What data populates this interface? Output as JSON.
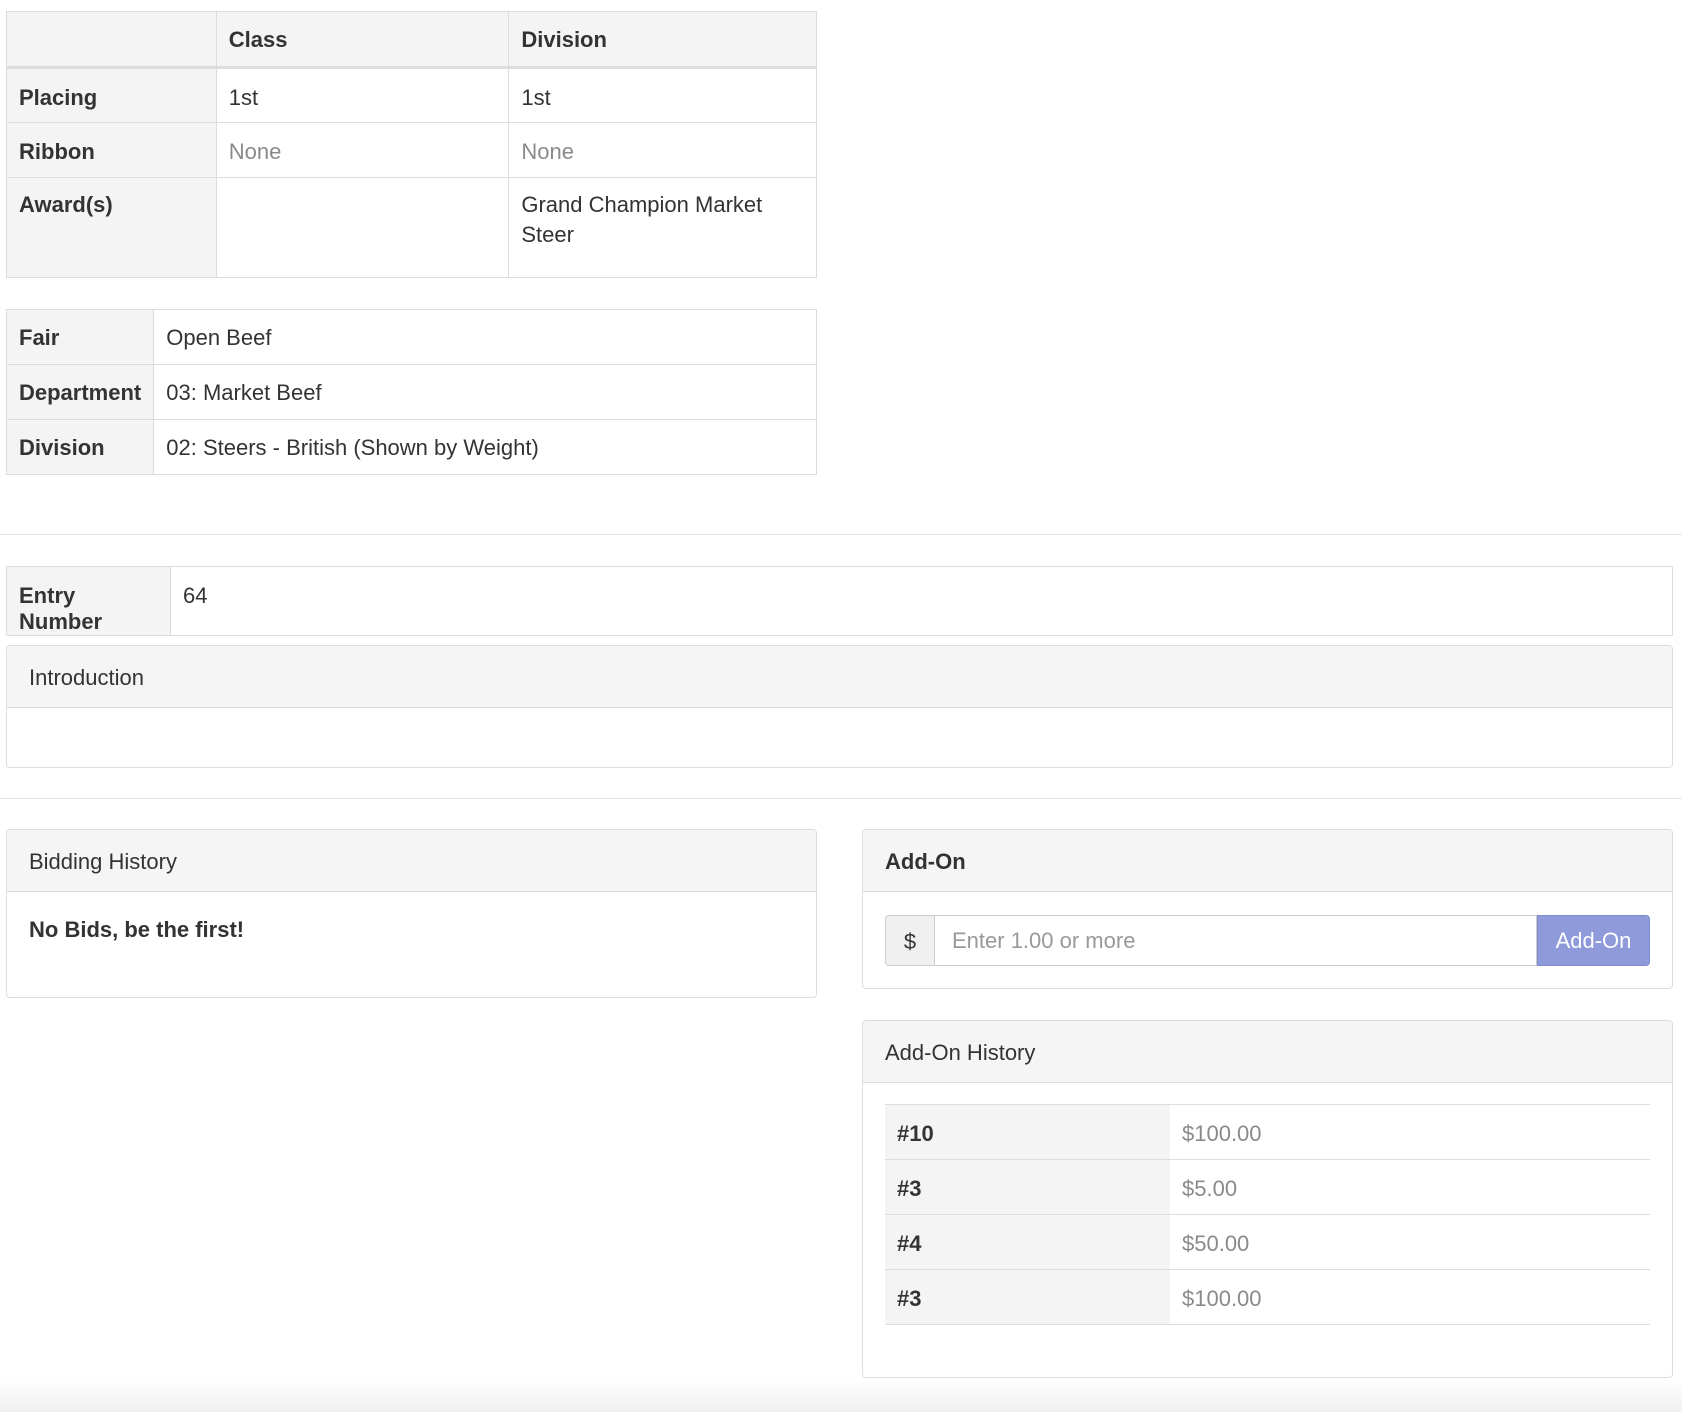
{
  "placings": {
    "headers": [
      "",
      "Class",
      "Division"
    ],
    "rows": [
      {
        "label": "Placing",
        "class": "1st",
        "division": "1st"
      },
      {
        "label": "Ribbon",
        "class": "None",
        "division": "None"
      },
      {
        "label": "Award(s)",
        "class": "",
        "division": "Grand Champion Market Steer"
      }
    ]
  },
  "fair_info": [
    {
      "label": "Fair",
      "value": "Open Beef"
    },
    {
      "label": "Department",
      "value": "03: Market Beef"
    },
    {
      "label": "Division",
      "value": "02: Steers - British (Shown by Weight)"
    }
  ],
  "entry": {
    "label": "Entry Number",
    "value": "64"
  },
  "introduction": {
    "title": "Introduction",
    "body": ""
  },
  "bidding": {
    "title": "Bidding History",
    "empty_message": "No Bids, be the first!"
  },
  "addon": {
    "title": "Add-On",
    "currency_symbol": "$",
    "placeholder": "Enter 1.00 or more",
    "button_label": "Add-On",
    "button_color": "#8e9ad9"
  },
  "addon_history": {
    "title": "Add-On History",
    "rows": [
      {
        "bidder": "#10",
        "amount": "$100.00"
      },
      {
        "bidder": "#3",
        "amount": "$5.00"
      },
      {
        "bidder": "#4",
        "amount": "$50.00"
      },
      {
        "bidder": "#3",
        "amount": "$100.00"
      }
    ]
  }
}
